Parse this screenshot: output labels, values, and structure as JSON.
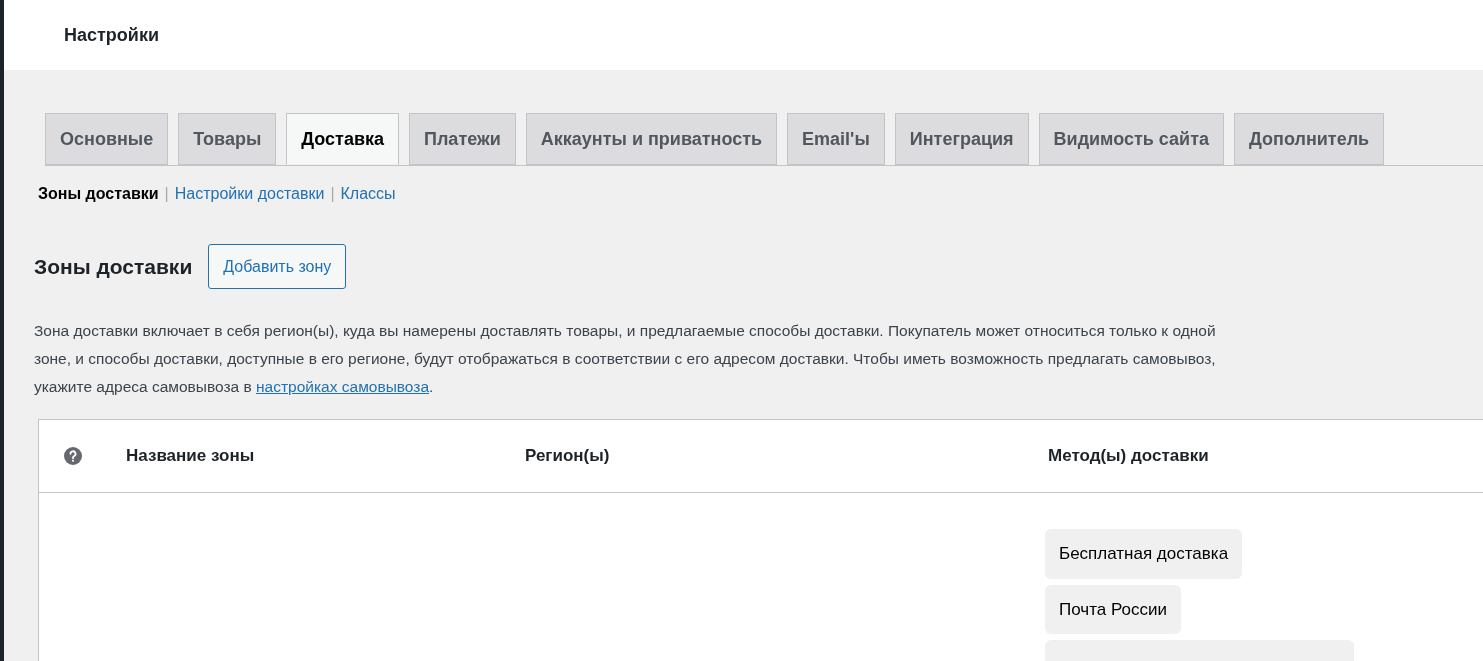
{
  "header": {
    "title": "Настройки"
  },
  "tabs": [
    {
      "label": "Основные",
      "selected": false
    },
    {
      "label": "Товары",
      "selected": false
    },
    {
      "label": "Доставка",
      "selected": true
    },
    {
      "label": "Платежи",
      "selected": false
    },
    {
      "label": "Аккаунты и приватность",
      "selected": false
    },
    {
      "label": "Email'ы",
      "selected": false
    },
    {
      "label": "Интеграция",
      "selected": false
    },
    {
      "label": "Видимость сайта",
      "selected": false
    },
    {
      "label": "Дополнитель",
      "selected": false
    }
  ],
  "subnav": [
    {
      "label": "Зоны доставки",
      "selected": true
    },
    {
      "separator": "|",
      "label": "Настройки доставки",
      "selected": false
    },
    {
      "separator": "|",
      "label": "Классы",
      "selected": false
    }
  ],
  "section": {
    "title": "Зоны доставки",
    "button": "Добавить зону",
    "description_before": "Зона доставки включает в себя регион(ы), куда вы намерены доставлять товары, и предлагаемые способы доставки. Покупатель может относиться только к одной зоне, и способы доставки, доступные в его регионе, будут отображаться в соответствии с его адресом доставки. Чтобы иметь возможность предлагать самовывоз, укажите адреса самовывоза в ",
    "description_link": "настройках самовывоза",
    "description_after": "."
  },
  "table": {
    "columns": [
      "Название зоны",
      "Регион(ы)",
      "Метод(ы) доставки"
    ],
    "rows": [
      {
        "methods": [
          "Бесплатная доставка",
          "Почта России"
        ]
      }
    ]
  }
}
